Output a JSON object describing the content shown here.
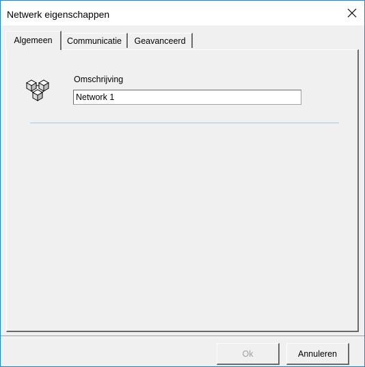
{
  "window": {
    "title": "Netwerk eigenschappen",
    "close_icon": "close-icon"
  },
  "tabs": [
    {
      "label": "Algemeen",
      "active": true
    },
    {
      "label": "Communicatie",
      "active": false
    },
    {
      "label": "Geavanceerd",
      "active": false
    }
  ],
  "general": {
    "icon": "network-icon",
    "description_label": "Omschrijving",
    "description_value": "Network 1"
  },
  "buttons": {
    "ok_label": "Ok",
    "ok_enabled": false,
    "cancel_label": "Annuleren"
  },
  "colors": {
    "window_border": "#1883d7",
    "separator": "#a9c9dd"
  }
}
